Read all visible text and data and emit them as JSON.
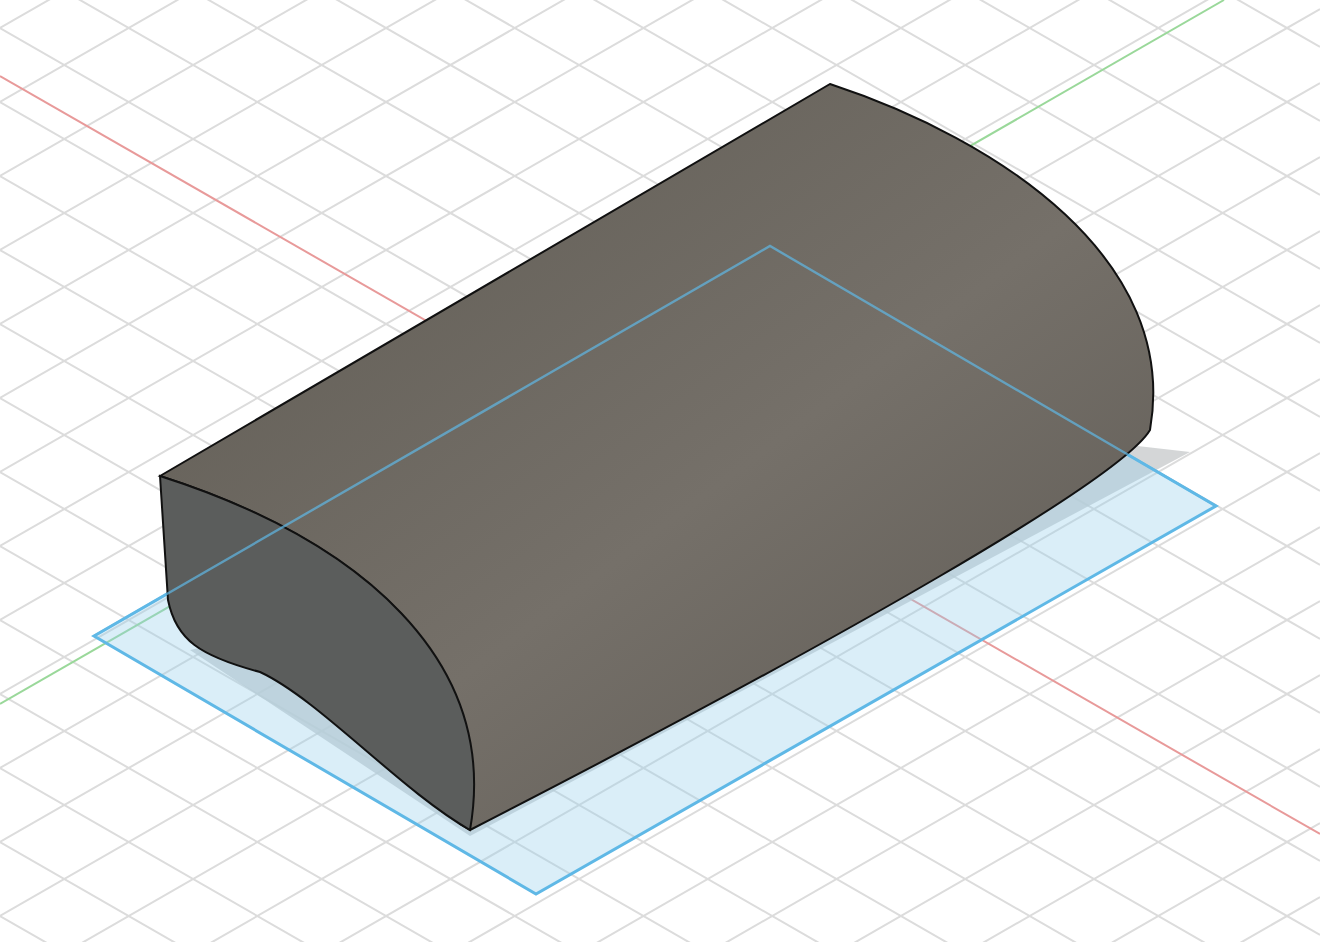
{
  "viewport": {
    "grid": true,
    "sketch_profile": true
  }
}
